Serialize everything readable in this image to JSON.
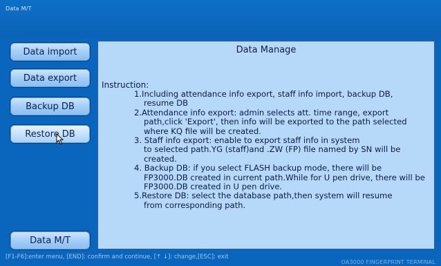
{
  "window": {
    "title": "Data M/T"
  },
  "sidebar": {
    "buttons": [
      {
        "label": "Data import"
      },
      {
        "label": "Data export"
      },
      {
        "label": "Backup DB"
      },
      {
        "label": "Restore DB"
      }
    ],
    "bottom_button": {
      "label": "Data M/T"
    }
  },
  "panel": {
    "title": "Data Manage",
    "heading": "Instruction:",
    "items": [
      {
        "line1": "1.Including attendance info export, staff info import, backup DB,",
        "rest": "resume DB"
      },
      {
        "line1": "2.Attendance info export: admin selects att. time range, export",
        "rest": "path,click 'Export', then info will be exported to the path selected where KQ file will be created."
      },
      {
        "line1": "3. Staff info export: enable to export staff info in system",
        "rest": "to selected path.YG (staff)and .ZW (FP) file named by SN will be created."
      },
      {
        "line1": "4. Backup DB: if you select FLASH backup mode, there will be",
        "rest": "FP3000.DB created in current path.While for U pen drive, there will be FP3000.DB created in U pen drive."
      },
      {
        "line1": "5.Restore DB: select the database path,then system will resume",
        "rest": "from corresponding path."
      }
    ]
  },
  "status": {
    "hint": "[F1-F6]:enter menu, [END]: confirm and continue, [↑ ↓]: change,[ESC]: exit",
    "brand": "OA3000 FINGERPRINT TERMINAL"
  }
}
